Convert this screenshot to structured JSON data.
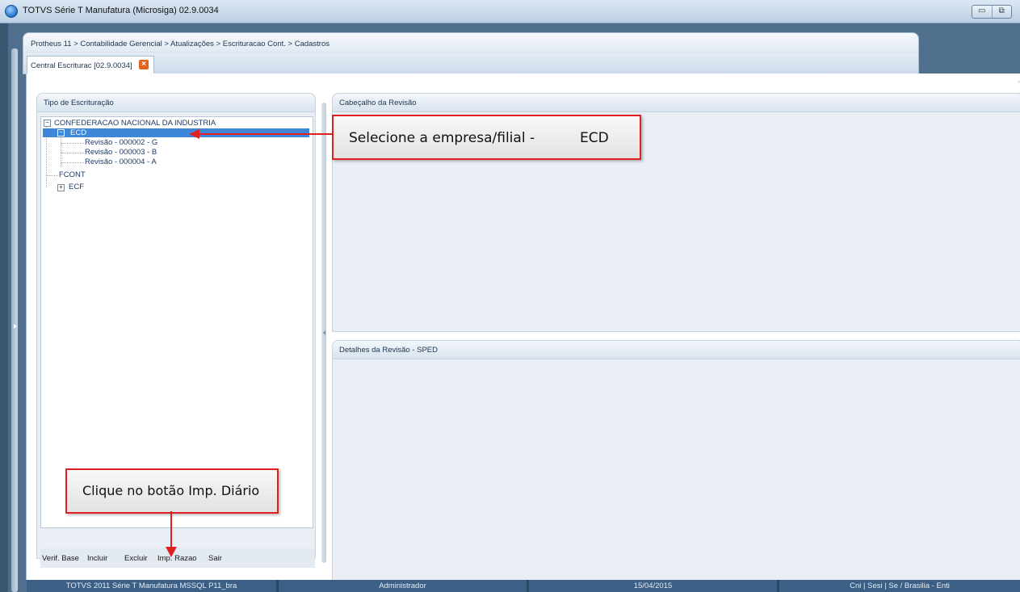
{
  "window": {
    "title": "TOTVS Série T Manufatura (Microsiga) 02.9.0034",
    "minimize_glyph": "▭",
    "restore_glyph": "⧉"
  },
  "breadcrumb": "Protheus 11 > Contabilidade Gerencial > Atualizações > Escrituracao Cont. > Cadastros",
  "tab": {
    "label": "Central Escriturac [02.9.0034]",
    "close_glyph": "×"
  },
  "left_panel": {
    "title": "Tipo de Escrituração",
    "tree": {
      "root": "CONFEDERACAO NACIONAL DA INDUSTRIA",
      "ecd": "ECD",
      "revisions": [
        "Revisão - 000002 - G",
        "Revisão - 000003 - B",
        "Revisão - 000004 - A"
      ],
      "fcont": "FCONT",
      "ecf": "ECF"
    },
    "buttons": [
      "Verif. Base",
      "Incluir",
      "Excluir",
      "Imp. Razao",
      "Sair"
    ]
  },
  "right_top_panel": {
    "title": "Cabeçalho da Revisão"
  },
  "right_bottom_panel": {
    "title": "Detalhes da Revisão - SPED"
  },
  "callouts": {
    "select": {
      "text": "Selecione a empresa/filial -",
      "tag": "ECD"
    },
    "click": {
      "text": "Clique no botão Imp. Diário"
    }
  },
  "statusbar": [
    "TOTVS 2011 Série T Manufatura MSSQL P11_bra",
    "Administrador",
    "15/04/2015",
    "Cni | Sesi | Se / Brasilia - Enti"
  ],
  "colors": {
    "accent_selection": "#3d86d8",
    "callout_border": "#e02020",
    "statusbar": "#3c5f86"
  },
  "icons": [
    "app-logo-icon",
    "minimize-icon",
    "restore-icon",
    "tab-close-icon",
    "tree-collapse-icon",
    "tree-expand-icon"
  ]
}
